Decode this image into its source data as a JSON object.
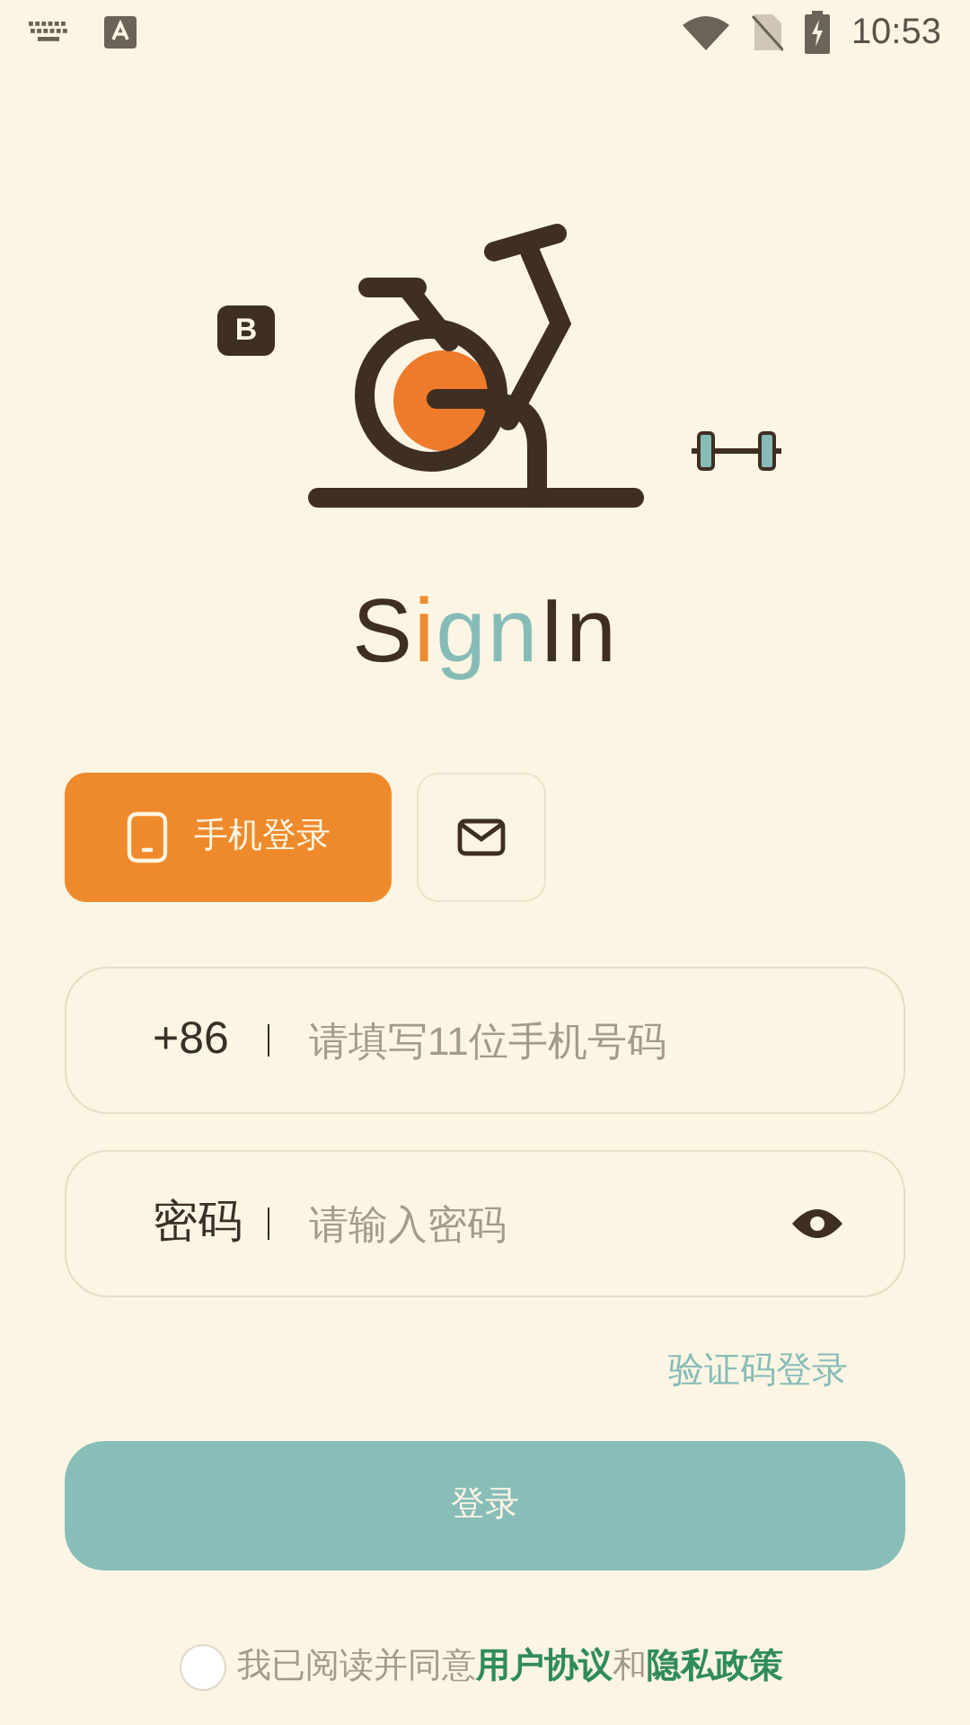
{
  "status_bar": {
    "time": "10:53"
  },
  "logo": {
    "badge": "B",
    "title_parts": [
      {
        "text": "S",
        "color": "#3f2e22"
      },
      {
        "text": "i",
        "color": "#ee8a2e"
      },
      {
        "text": "gn",
        "color": "#86bcb8"
      },
      {
        "text": "In",
        "color": "#3f2e22"
      }
    ]
  },
  "tabs": [
    {
      "kind": "phone",
      "label": "手机登录",
      "selected": true
    },
    {
      "kind": "email",
      "selected": false
    }
  ],
  "fields": [
    {
      "kind": "phone",
      "prefix": "+86",
      "placeholder": "请填写11位手机号码"
    },
    {
      "kind": "password",
      "prefix": "密码",
      "placeholder": "请输入密码"
    }
  ],
  "alt_login_link": "验证码登录",
  "login_button": "登录",
  "agreement": {
    "checked": false,
    "text": "我已阅读并同意",
    "links": [
      {
        "kind": "link",
        "text": "用户协议"
      },
      {
        "kind": "plain",
        "text": "和"
      },
      {
        "kind": "link",
        "text": "隐私政策"
      }
    ]
  }
}
